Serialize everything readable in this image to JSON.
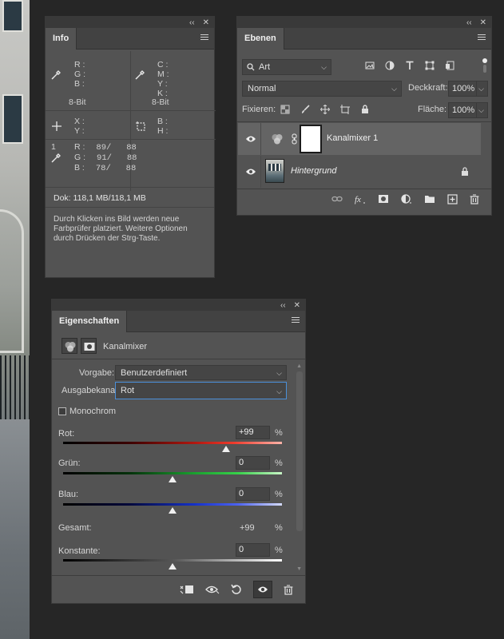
{
  "info": {
    "tab": "Info",
    "rgb_labels": [
      "R :",
      "G :",
      "B :"
    ],
    "cmyk_labels": [
      "C :",
      "M :",
      "Y :",
      "K :"
    ],
    "bit_left": "8-Bit",
    "bit_right": "8-Bit",
    "xy_labels": [
      "X :",
      "Y :"
    ],
    "bh_labels": [
      "B :",
      "H :"
    ],
    "sampler_index": "1",
    "sampler_rows": [
      {
        "label": "R :",
        "value": "89/   88"
      },
      {
        "label": "G :",
        "value": "91/   88"
      },
      {
        "label": "B :",
        "value": "78/   88"
      }
    ],
    "doc": "Dok: 118,1 MB/118,1 MB",
    "hint": "Durch Klicken ins Bild werden neue Farbprüfer platziert. Weitere Optionen durch Drücken der Strg-Taste."
  },
  "layers": {
    "tab": "Ebenen",
    "filter_kind": "Art",
    "blend_mode": "Normal",
    "opacity_label": "Deckkraft:",
    "opacity_value": "100%",
    "lock_label": "Fixieren:",
    "fill_label": "Fläche:",
    "fill_value": "100%",
    "items": [
      {
        "name": "Kanalmixer 1"
      },
      {
        "name": "Hintergrund"
      }
    ]
  },
  "props": {
    "tab": "Eigenschaften",
    "adj_title": "Kanalmixer",
    "preset_label": "Vorgabe:",
    "preset_value": "Benutzerdefiniert",
    "output_label": "Ausgabekanal:",
    "output_value": "Rot",
    "mono_label": "Monochrom",
    "red_label": "Rot:",
    "red_value": "+99",
    "red_fraction": 0.745,
    "green_label": "Grün:",
    "green_value": "0",
    "green_fraction": 0.5,
    "blue_label": "Blau:",
    "blue_value": "0",
    "blue_fraction": 0.5,
    "total_label": "Gesamt:",
    "total_value": "+99",
    "const_label": "Konstante:",
    "const_value": "0",
    "const_fraction": 0.5,
    "pct": "%"
  },
  "colors": {
    "panel_bg": "#535353",
    "accent_focus": "#4a8fd8"
  }
}
